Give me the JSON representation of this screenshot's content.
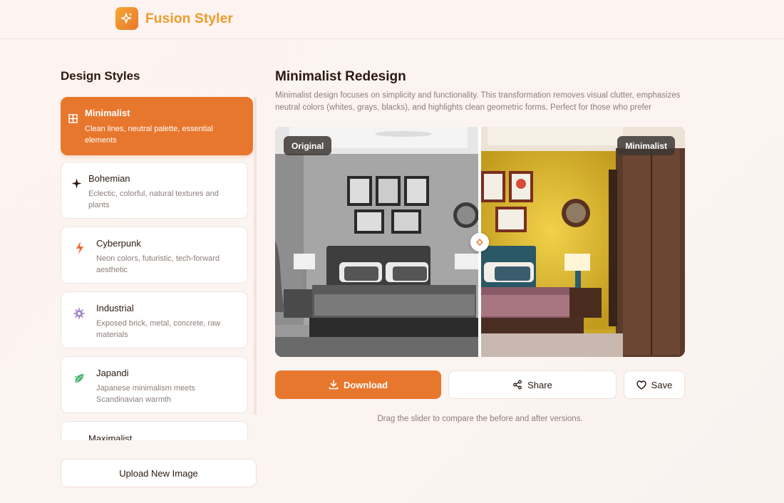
{
  "app": {
    "brand": "Fusion Styler",
    "accent": "#e8772e"
  },
  "sidebar": {
    "title": "Design Styles",
    "upload_label": "Upload New Image",
    "styles": [
      {
        "name": "Minimalist",
        "desc": "Clean lines, neutral palette, essential elements",
        "icon": "grid-icon",
        "active": true
      },
      {
        "name": "Bohemian",
        "desc": "Eclectic, colorful, natural textures and plants",
        "icon": "sparkle-icon",
        "active": false
      },
      {
        "name": "Cyberpunk",
        "desc": "Neon colors, futuristic, tech-forward aesthetic",
        "icon": "lightning-icon",
        "active": false
      },
      {
        "name": "Industrial",
        "desc": "Exposed brick, metal, concrete, raw materials",
        "icon": "gear-icon",
        "active": false
      },
      {
        "name": "Japandi",
        "desc": "Japanese minimalism meets Scandinavian warmth",
        "icon": "leaf-icon",
        "active": false
      },
      {
        "name": "Maximalist",
        "desc": "",
        "icon": "triangle-icon",
        "active": false
      }
    ]
  },
  "main": {
    "title": "Minimalist Redesign",
    "description": "Minimalist design focuses on simplicity and functionality. This transformation removes visual clutter, emphasizes neutral colors (whites, grays, blacks), and highlights clean geometric forms. Perfect for those who prefer spacious,...",
    "compare": {
      "left_label": "Original",
      "right_label": "Minimalist"
    },
    "actions": {
      "download": "Download",
      "share": "Share",
      "save": "Save"
    },
    "hint": "Drag the slider to compare the before and after versions."
  }
}
